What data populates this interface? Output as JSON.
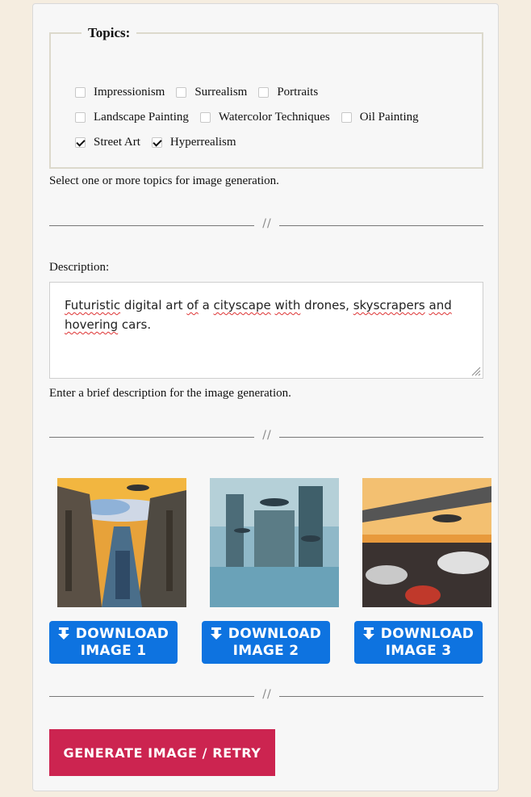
{
  "topics": {
    "legend": "Topics:",
    "items": [
      {
        "label": "Impressionism",
        "checked": false
      },
      {
        "label": "Surrealism",
        "checked": false
      },
      {
        "label": "Portraits",
        "checked": false
      },
      {
        "label": "Landscape Painting",
        "checked": false
      },
      {
        "label": "Watercolor Techniques",
        "checked": false
      },
      {
        "label": "Oil Painting",
        "checked": false
      },
      {
        "label": "Street Art",
        "checked": true
      },
      {
        "label": "Hyperrealism",
        "checked": true
      }
    ],
    "hint": "Select one or more topics for image generation."
  },
  "separator": {
    "mark": "//"
  },
  "description": {
    "label": "Description:",
    "value_parts": [
      {
        "text": "Futuristic",
        "spell": true
      },
      {
        "text": " digital art ",
        "spell": false
      },
      {
        "text": "of",
        "spell": true
      },
      {
        "text": " a ",
        "spell": false
      },
      {
        "text": "cityscape",
        "spell": true
      },
      {
        "text": " ",
        "spell": false
      },
      {
        "text": "with",
        "spell": true
      },
      {
        "text": " drones, ",
        "spell": false
      },
      {
        "text": "skyscrapers",
        "spell": true
      },
      {
        "text": " ",
        "spell": false
      },
      {
        "text": "and",
        "spell": true
      },
      {
        "text": " ",
        "spell": false
      },
      {
        "text": "hovering",
        "spell": true
      },
      {
        "text": " cars.",
        "spell": false
      }
    ],
    "hint": "Enter a brief description for the image generation."
  },
  "images": [
    {
      "download_line1": "DOWNLOAD",
      "download_line2": "IMAGE 1"
    },
    {
      "download_line1": "DOWNLOAD",
      "download_line2": "IMAGE 2"
    },
    {
      "download_line1": "DOWNLOAD",
      "download_line2": "IMAGE 3"
    }
  ],
  "generate_label": "GENERATE IMAGE / RETRY",
  "colors": {
    "download": "#0e73e0",
    "generate": "#cc2450",
    "background": "#f5ede0"
  }
}
